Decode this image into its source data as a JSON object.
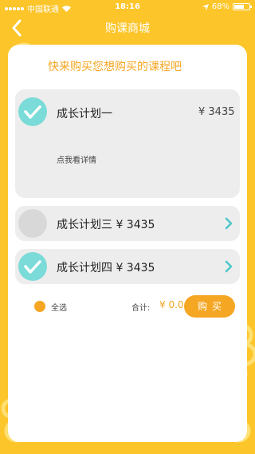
{
  "status_bar": {
    "carrier": "中国联通",
    "time": "18:16",
    "battery": "68%",
    "battery_level": 0.68
  },
  "nav": {
    "title": "购课商城",
    "back_icon": "chevron-left-icon"
  },
  "heading": "快来购买您想购买的课程吧",
  "courses": [
    {
      "name": "成长计划一",
      "price": "¥ 3435",
      "detail_link": "点我看详情",
      "selected": true
    },
    {
      "name": "成长计划三 ¥ 3435",
      "selected": false
    },
    {
      "name": "成长计划四 ¥ 3435",
      "selected": true
    }
  ],
  "footer": {
    "select_all_label": "全选",
    "total_label": "合计:",
    "total_value": "¥ 0.0",
    "buy_label": "购买"
  },
  "colors": {
    "background": "#FCC52A",
    "accent": "#F5A623",
    "check": "#7ADBD8",
    "chevron": "#4CC6C9"
  }
}
